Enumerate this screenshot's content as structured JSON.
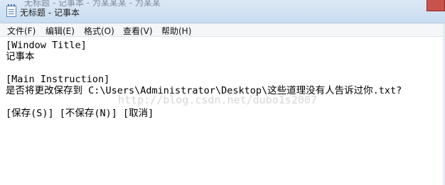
{
  "titlebar": {
    "title": "无标题 - 记事本",
    "ghost_text": "无标题 - 记事本 - 为某某某 - 为某某"
  },
  "menu": {
    "file": "文件(F)",
    "edit": "编辑(E)",
    "format": "格式(O)",
    "view": "查看(V)",
    "help": "帮助(H)"
  },
  "document": {
    "lines": [
      "[Window Title]",
      "记事本",
      "",
      "[Main Instruction]",
      "是否将更改保存到 C:\\Users\\Administrator\\Desktop\\这些道理没有人告诉过你.txt?",
      "",
      "[保存(S)] [不保存(N)] [取消]"
    ],
    "watermark": "http://blog.csdn.net/dubo1s2007"
  }
}
